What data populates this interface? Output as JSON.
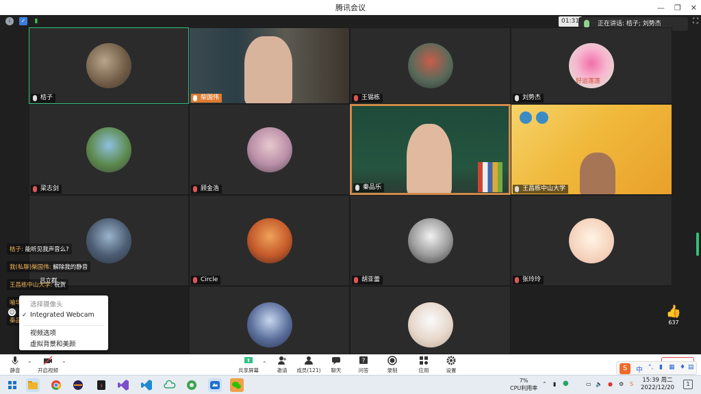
{
  "window": {
    "title": "腾讯会议"
  },
  "infobar": {
    "timer": "01:31",
    "speaking_label": "正在讲话: 桔子; 刘势杰"
  },
  "participants": [
    {
      "name": "桔子"
    },
    {
      "name": "柴国伟"
    },
    {
      "name": "王锡栋"
    },
    {
      "name": "刘势杰"
    },
    {
      "name": "梁志剑"
    },
    {
      "name": "顾金浩"
    },
    {
      "name": "秦品乐"
    },
    {
      "name": "王昌栋中山大学"
    },
    {
      "name": ""
    },
    {
      "name": "Circle"
    },
    {
      "name": "胡亚蕾"
    },
    {
      "name": "张玲玲"
    },
    {
      "name": ""
    },
    {
      "name": ""
    },
    {
      "name": ""
    }
  ],
  "avatar_overlay": {
    "lotus_caption": "好运莲莲"
  },
  "chat": [
    {
      "from": "桔子:",
      "text": "能听见我声音么?"
    },
    {
      "from": "我(私聊)柴国伟:",
      "text": "解除我的静音"
    },
    {
      "from": "王昌栋中山大学:",
      "text": "祝贺"
    },
    {
      "from": "喻华兵:",
      "text": "祝贺"
    },
    {
      "from": "秦品",
      "text": ""
    }
  ],
  "tile_name_partial": "吕立群",
  "camera_menu": {
    "header": "选择摄像头",
    "selected": "Integrated Webcam",
    "options": [
      "视频选项",
      "虚拟背景和美颜"
    ]
  },
  "reaction": {
    "count": "637"
  },
  "toolbar": {
    "mute": "静音",
    "video": "开启视频",
    "share": "共享屏幕",
    "invite": "邀请",
    "members": "成员(121)",
    "chat": "聊天",
    "qa": "问答",
    "record": "录制",
    "apps": "应用",
    "settings": "设置",
    "end": "离开会议"
  },
  "taskbar": {
    "cpu_percent": "7%",
    "cpu_label": "CPU利用率",
    "time": "15:39 周二",
    "date": "2022/12/20",
    "ime_lang": "中",
    "notification_count": "1"
  },
  "colors": {
    "active_border": "#2ec27e",
    "end_button": "#e04444",
    "chat_sender": "#f2b65b"
  }
}
